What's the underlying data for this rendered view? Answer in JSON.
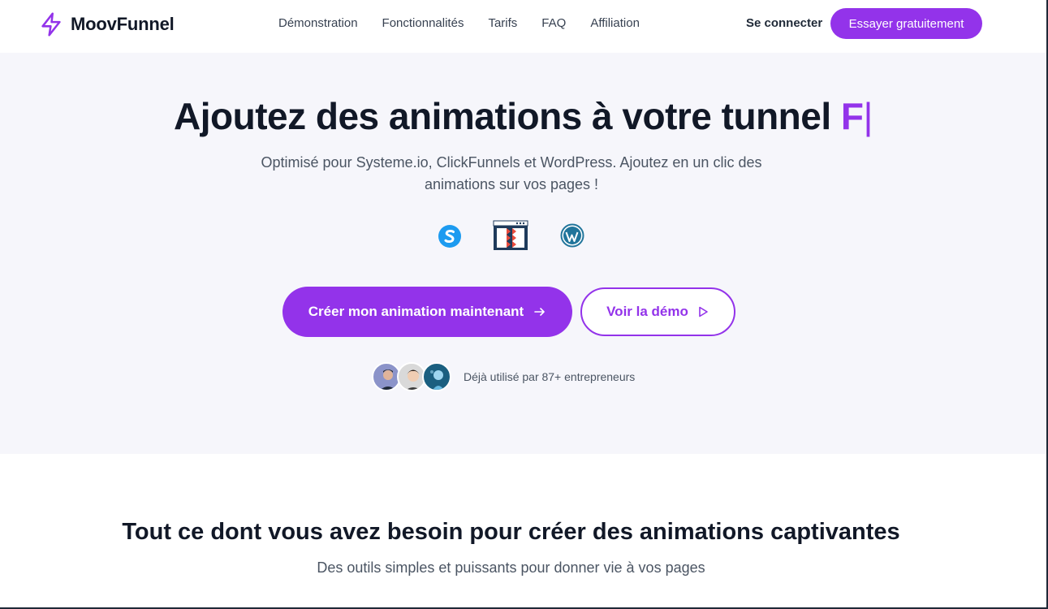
{
  "brand": {
    "name": "MoovFunnel",
    "accent": "#9333ea"
  },
  "nav": {
    "items": [
      {
        "label": "Démonstration"
      },
      {
        "label": "Fonctionnalités"
      },
      {
        "label": "Tarifs"
      },
      {
        "label": "FAQ"
      },
      {
        "label": "Affiliation"
      }
    ],
    "login_label": "Se connecter",
    "cta_label": "Essayer gratuitement"
  },
  "hero": {
    "title": "Ajoutez des animations à votre tunnel",
    "typed": "F",
    "caret": "|",
    "subtitle": "Optimisé pour Systeme.io, ClickFunnels et WordPress. Ajoutez en un clic des animations sur vos pages !",
    "platforms": [
      {
        "icon": "systeme-io-icon"
      },
      {
        "icon": "clickfunnels-icon"
      },
      {
        "icon": "wordpress-icon"
      }
    ],
    "primary_button": "Créer mon animation maintenant",
    "secondary_button": "Voir la démo",
    "social_proof": "Déjà utilisé par 87+ entrepreneurs"
  },
  "features": {
    "title": "Tout ce dont vous avez besoin pour créer des animations captivantes",
    "subtitle": "Des outils simples et puissants pour donner vie à vos pages"
  }
}
